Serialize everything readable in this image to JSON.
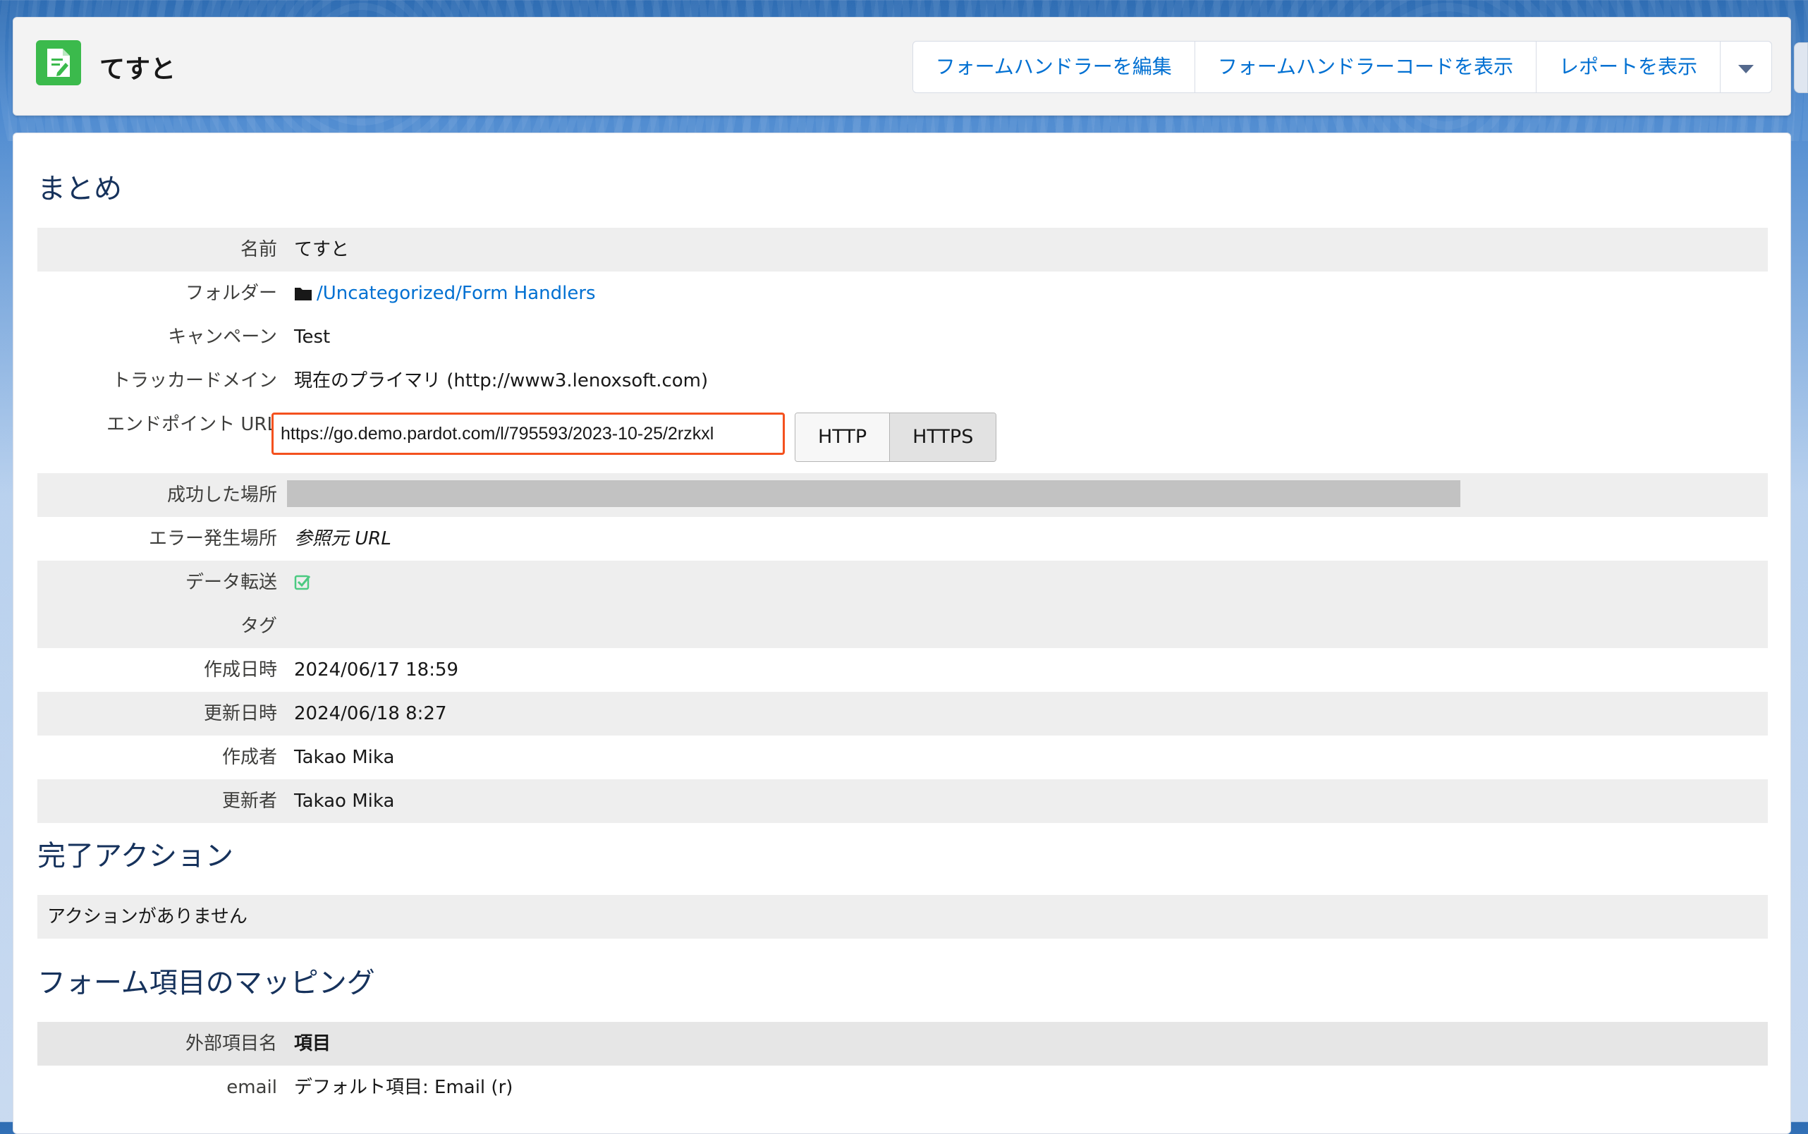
{
  "header": {
    "title": "てすと",
    "icon": "form-handler-icon",
    "buttons": {
      "edit": "フォームハンドラーを編集",
      "view_code": "フォームハンドラーコードを表示",
      "view_report": "レポートを表示"
    },
    "more_icon": "chevron-down-icon"
  },
  "summary": {
    "title": "まとめ",
    "name": {
      "label": "名前",
      "value": "てすと"
    },
    "folder": {
      "label": "フォルダー",
      "value": "/Uncategorized/Form Handlers",
      "icon": "folder-icon"
    },
    "campaign": {
      "label": "キャンペーン",
      "value": "Test"
    },
    "tracker_domain": {
      "label": "トラッカードメイン",
      "value": "現在のプライマリ (http://www3.lenoxsoft.com)"
    },
    "endpoint_url": {
      "label": "エンドポイント URL",
      "value": "https://go.demo.pardot.com/l/795593/2023-10-25/2rzkxl",
      "http_label": "HTTP",
      "https_label": "HTTPS"
    },
    "success_location": {
      "label": "成功した場所",
      "value": ""
    },
    "error_location": {
      "label": "エラー発生場所",
      "value": "参照元 URL"
    },
    "data_forwarding": {
      "label": "データ転送",
      "checked": true,
      "icon": "checkbox-checked-icon"
    },
    "tags": {
      "label": "タグ",
      "value": ""
    },
    "created_at": {
      "label": "作成日時",
      "value": "2024/06/17 18:59"
    },
    "updated_at": {
      "label": "更新日時",
      "value": "2024/06/18 8:27"
    },
    "created_by": {
      "label": "作成者",
      "value": "Takao Mika"
    },
    "updated_by": {
      "label": "更新者",
      "value": "Takao Mika"
    }
  },
  "completion_actions": {
    "title": "完了アクション",
    "empty_text": "アクションがありません"
  },
  "field_mapping": {
    "title": "フォーム項目のマッピング",
    "columns": {
      "external": "外部項目名",
      "field": "項目"
    },
    "rows": [
      {
        "external": "email",
        "field": "デフォルト項目: Email (r)"
      }
    ]
  },
  "colors": {
    "link": "#0070d2",
    "section_title": "#16325c",
    "icon_bg": "#3bba4c",
    "highlight_border": "#f4511e",
    "check": "#4bca81"
  }
}
